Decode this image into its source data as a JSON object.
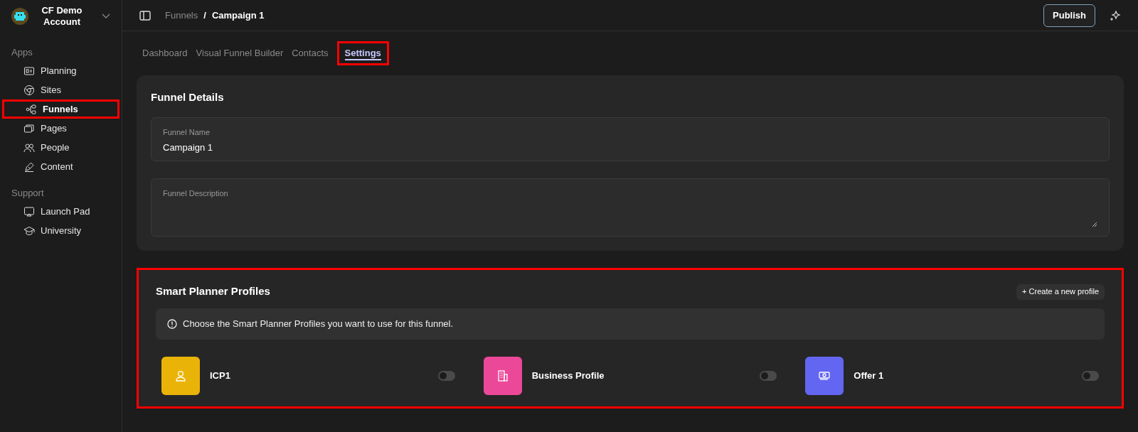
{
  "account": {
    "name": "CF Demo Account"
  },
  "sidebar": {
    "sections": [
      {
        "title": "Apps",
        "items": [
          {
            "label": "Planning",
            "kind": "planning",
            "selected": false,
            "highlighted": false
          },
          {
            "label": "Sites",
            "kind": "sites",
            "selected": false,
            "highlighted": false
          },
          {
            "label": "Funnels",
            "kind": "funnels",
            "selected": true,
            "highlighted": true
          },
          {
            "label": "Pages",
            "kind": "pages",
            "selected": false,
            "highlighted": false
          },
          {
            "label": "People",
            "kind": "people",
            "selected": false,
            "highlighted": false
          },
          {
            "label": "Content",
            "kind": "content",
            "selected": false,
            "highlighted": false
          }
        ]
      },
      {
        "title": "Support",
        "items": [
          {
            "label": "Launch Pad",
            "kind": "launch",
            "selected": false,
            "highlighted": false
          },
          {
            "label": "University",
            "kind": "university",
            "selected": false,
            "highlighted": false
          }
        ]
      }
    ]
  },
  "breadcrumb": [
    "Funnels",
    "Campaign 1"
  ],
  "breadcrumb_separator": "/",
  "publish_button": "Publish",
  "tabs": [
    {
      "label": "Dashboard",
      "selected": false,
      "highlighted": false
    },
    {
      "label": "Visual Funnel Builder",
      "selected": false,
      "highlighted": false
    },
    {
      "label": "Contacts",
      "selected": false,
      "highlighted": false
    },
    {
      "label": "Settings",
      "selected": true,
      "highlighted": true
    }
  ],
  "funnel_details": {
    "title": "Funnel Details",
    "name_field": {
      "label": "Funnel Name",
      "value": "Campaign 1"
    },
    "description_field": {
      "label": "Funnel Description"
    }
  },
  "profiles": {
    "title": "Smart Planner Profiles",
    "highlighted": true,
    "create_button": "+ Create a new profile",
    "notice": "Choose the Smart Planner Profiles you want to use for this funnel.",
    "items": [
      {
        "name": "ICP1",
        "kind": "person",
        "color": "#eab308",
        "on": false
      },
      {
        "name": "Business Profile",
        "kind": "building",
        "color": "#ec4899",
        "on": false
      },
      {
        "name": "Offer 1",
        "kind": "money",
        "color": "#6366f1",
        "on": false
      }
    ]
  }
}
